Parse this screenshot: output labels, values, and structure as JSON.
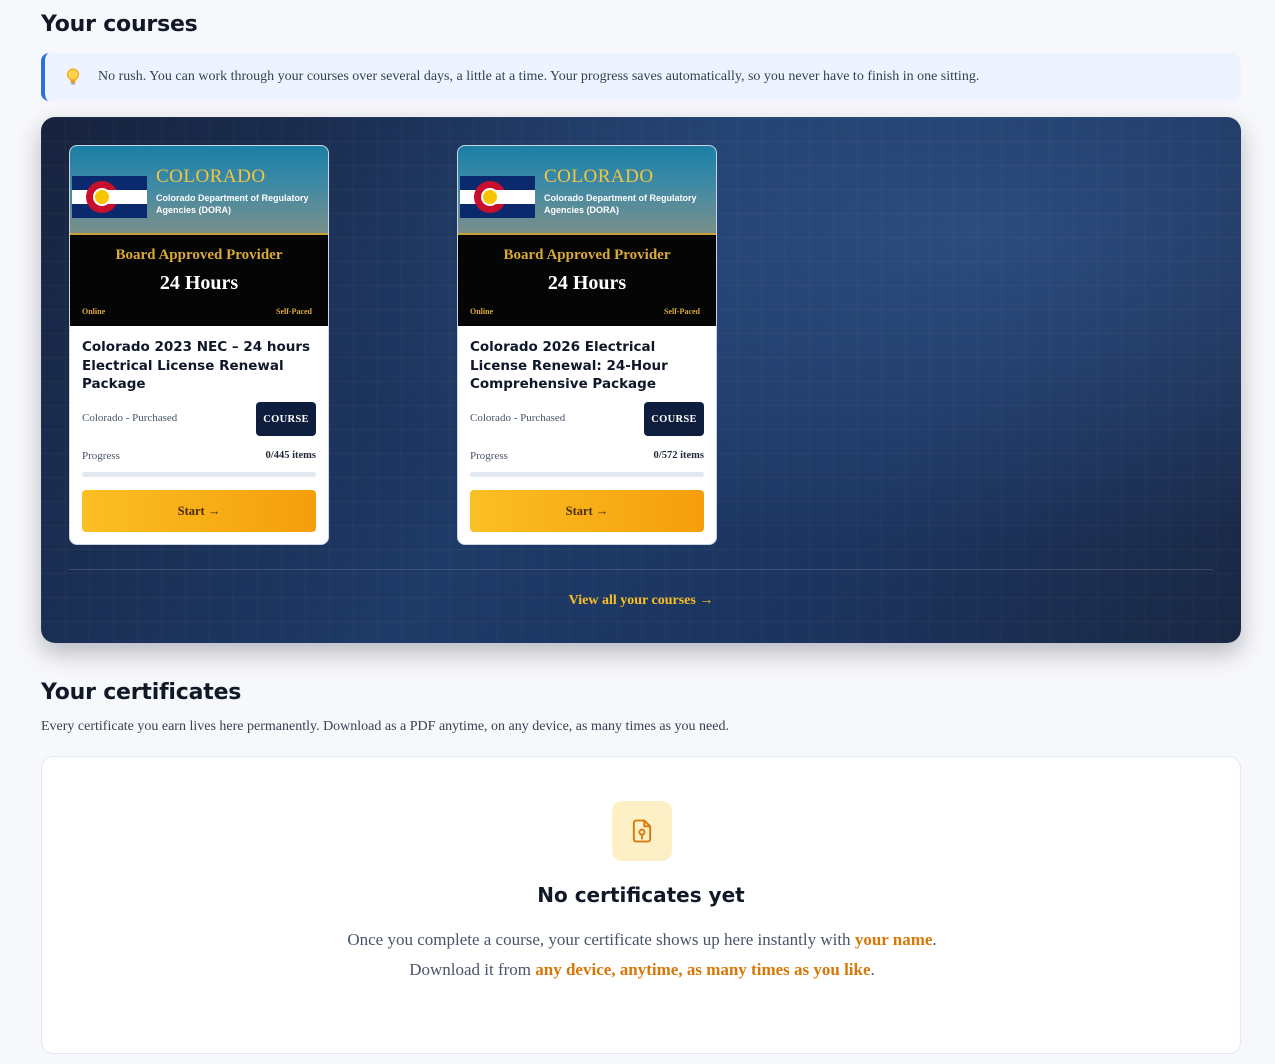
{
  "courses_section": {
    "title": "Your courses",
    "tip": "No rush. You can work through your courses over several days, a little at a time. Your progress saves automatically, so you never have to finish in one sitting."
  },
  "courses": [
    {
      "banner": {
        "state": "COLORADO",
        "dept": "Colorado Department of Regulatory Agencies (DORA)",
        "approved": "Board Approved Provider",
        "hours": "24 Hours",
        "online": "Online",
        "self_paced": "Self-Paced"
      },
      "title": "Colorado 2023 NEC – 24 hours Electrical License Renewal Package",
      "meta": "Colorado - Purchased",
      "badge": "COURSE",
      "progress_label": "Progress",
      "progress_count": "0/445 items",
      "progress_fraction": 0,
      "start_label": "Start →"
    },
    {
      "banner": {
        "state": "COLORADO",
        "dept": "Colorado Department of Regulatory Agencies (DORA)",
        "approved": "Board Approved Provider",
        "hours": "24 Hours",
        "online": "Online",
        "self_paced": "Self-Paced"
      },
      "title": "Colorado 2026 Electrical License Renewal: 24-Hour Comprehensive Package",
      "meta": "Colorado - Purchased",
      "badge": "COURSE",
      "progress_label": "Progress",
      "progress_count": "0/572 items",
      "progress_fraction": 0,
      "start_label": "Start →"
    }
  ],
  "view_all": "View all your courses →",
  "certificates_section": {
    "title": "Your certificates",
    "description": "Every certificate you earn lives here permanently. Download as a PDF anytime, on any device, as many times as you need.",
    "empty_title": "No certificates yet",
    "empty_text_1": "Once you complete a course, your certificate shows up here instantly with ",
    "empty_hl_1": "your name",
    "empty_text_2": ". Download it from ",
    "empty_hl_2": "any device, anytime, as many times as you like",
    "empty_text_3": "."
  },
  "icons": {
    "tip": "lightbulb-icon",
    "certificate": "certificate-file-icon"
  },
  "colors": {
    "accent": "#f59e0b",
    "panel_dark": "#1e3a67",
    "badge": "#0f1e3d",
    "tip_border": "#2f6fde",
    "highlight": "#d97706"
  }
}
